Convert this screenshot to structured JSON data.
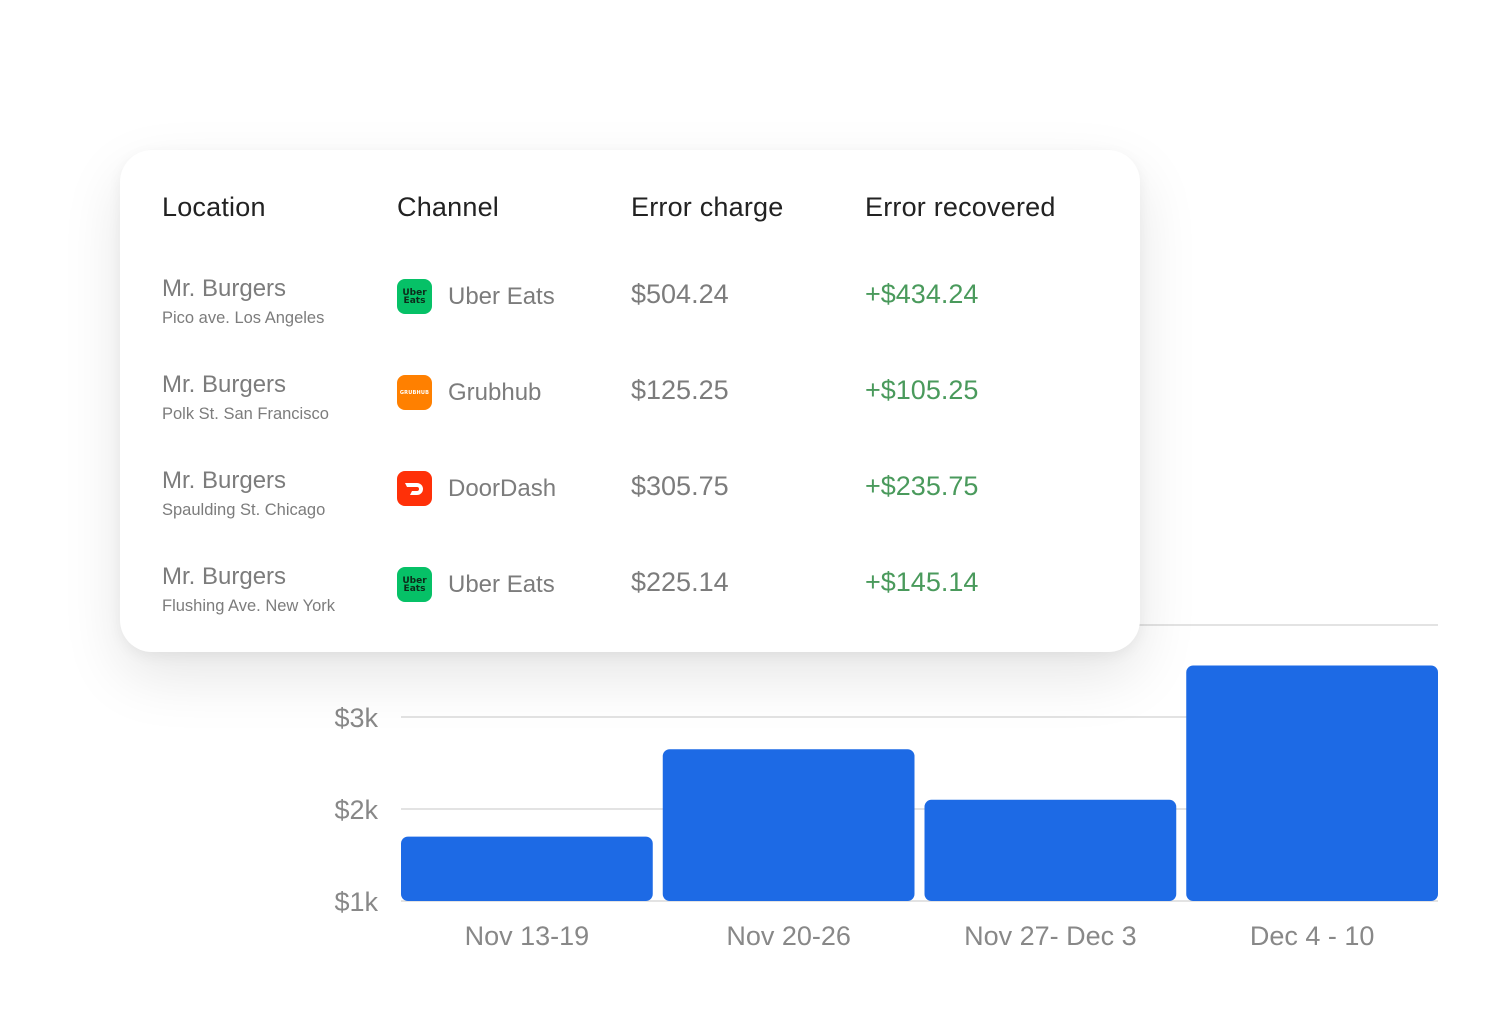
{
  "table": {
    "headers": {
      "location": "Location",
      "channel": "Channel",
      "error_charge": "Error charge",
      "error_recovered": "Error recovered"
    },
    "rows": [
      {
        "location_name": "Mr. Burgers",
        "location_address": "Pico ave. Los Angeles",
        "channel": "Uber Eats",
        "channel_icon": "uber-eats-logo",
        "error_charge": "$504.24",
        "error_recovered": "+$434.24"
      },
      {
        "location_name": "Mr. Burgers",
        "location_address": "Polk St. San Francisco",
        "channel": "Grubhub",
        "channel_icon": "grubhub-logo",
        "error_charge": "$125.25",
        "error_recovered": "+$105.25"
      },
      {
        "location_name": "Mr. Burgers",
        "location_address": "Spaulding St. Chicago",
        "channel": "DoorDash",
        "channel_icon": "doordash-logo",
        "error_charge": "$305.75",
        "error_recovered": "+$235.75"
      },
      {
        "location_name": "Mr. Burgers",
        "location_address": "Flushing Ave. New York",
        "channel": "Uber Eats",
        "channel_icon": "uber-eats-logo",
        "error_charge": "$225.14",
        "error_recovered": "+$145.14"
      }
    ],
    "logo_text": {
      "uber_line1": "Uber",
      "uber_line2": "Eats",
      "grubhub": "GRUBHUB"
    }
  },
  "colors": {
    "bar": "#1d6ae5",
    "recovered_text": "#4a9a5c",
    "uber_eats": "#06c167",
    "grubhub": "#ff8000",
    "doordash": "#ff3008"
  },
  "chart_data": {
    "type": "bar",
    "categories": [
      "Nov 13-19",
      "Nov 20-26",
      "Nov 27- Dec 3",
      "Dec 4 - 10"
    ],
    "values": [
      1700,
      2650,
      2100,
      3560
    ],
    "yticks": [
      {
        "value": 1000,
        "label": "$1k"
      },
      {
        "value": 2000,
        "label": "$2k"
      },
      {
        "value": 3000,
        "label": "$3k"
      }
    ],
    "ylim": [
      1000,
      4000
    ],
    "grid": true,
    "legend": "none"
  }
}
